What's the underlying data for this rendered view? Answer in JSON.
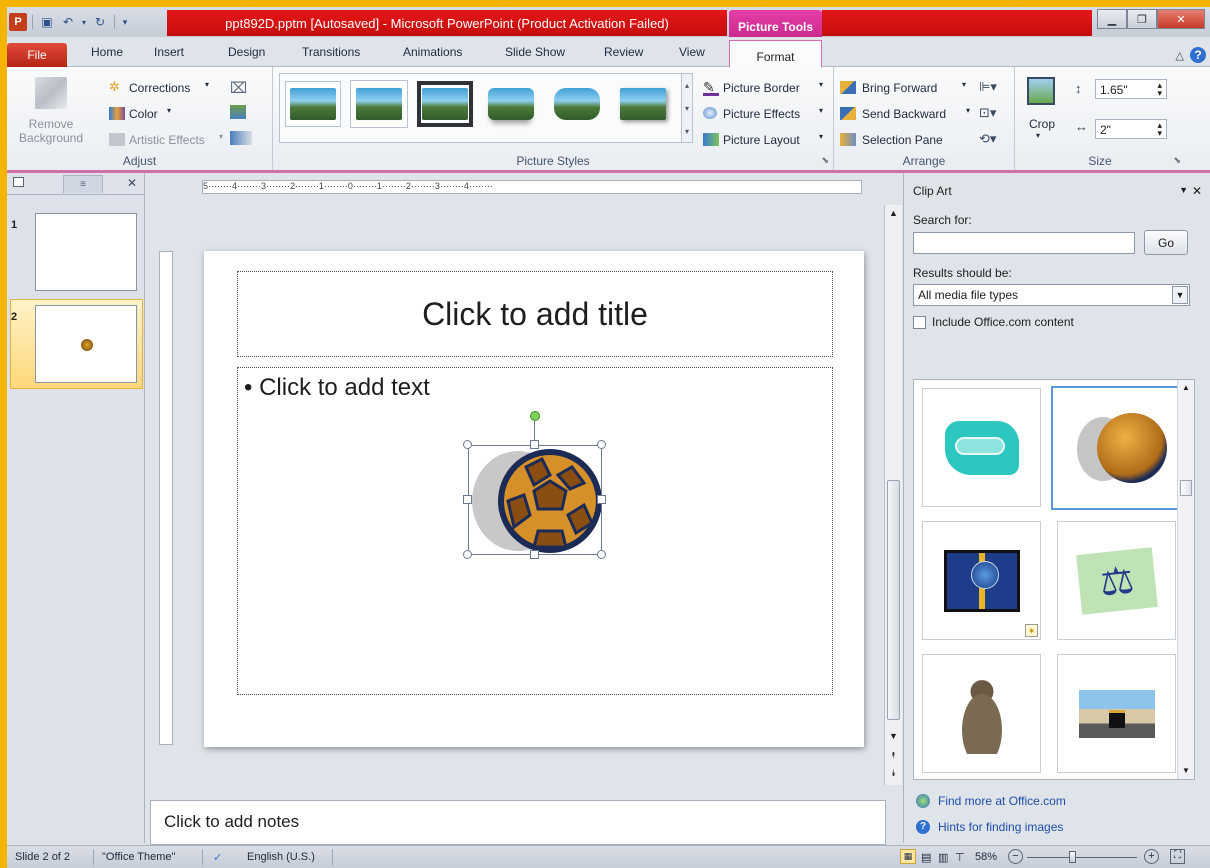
{
  "window": {
    "title": "ppt892D.pptm [Autosaved] - Microsoft PowerPoint (Product Activation Failed)",
    "context_tab": "Picture Tools"
  },
  "tabs": [
    "File",
    "Home",
    "Insert",
    "Design",
    "Transitions",
    "Animations",
    "Slide Show",
    "Review",
    "View",
    "Format"
  ],
  "ribbon": {
    "adjust": {
      "label": "Adjust",
      "remove_background": "Remove Background",
      "corrections": "Corrections",
      "color": "Color",
      "artistic_effects": "Artistic Effects"
    },
    "picture_styles": {
      "label": "Picture Styles",
      "picture_border": "Picture Border",
      "picture_effects": "Picture Effects",
      "picture_layout": "Picture Layout"
    },
    "arrange": {
      "label": "Arrange",
      "bring_forward": "Bring Forward",
      "send_backward": "Send Backward",
      "selection_pane": "Selection Pane"
    },
    "size": {
      "label": "Size",
      "crop": "Crop",
      "height": "1.65\"",
      "width": "2\""
    }
  },
  "slides_panel": {
    "slides": [
      {
        "number": "1"
      },
      {
        "number": "2"
      }
    ]
  },
  "ruler_text": "5········4········3········2········1········0········1········2········3········4········",
  "slide": {
    "title_placeholder": "Click to add title",
    "body_placeholder": "Click to add text"
  },
  "notes_placeholder": "Click to add notes",
  "clip_art": {
    "title": "Clip Art",
    "search_label": "Search for:",
    "search_value": "",
    "go": "Go",
    "results_label": "Results should be:",
    "results_value": "All media file types",
    "include_office": "Include Office.com content",
    "find_more": "Find more at Office.com",
    "hints": "Hints for finding images"
  },
  "status": {
    "slide": "Slide 2 of 2",
    "theme": "\"Office Theme\"",
    "language": "English (U.S.)",
    "zoom": "58%"
  }
}
